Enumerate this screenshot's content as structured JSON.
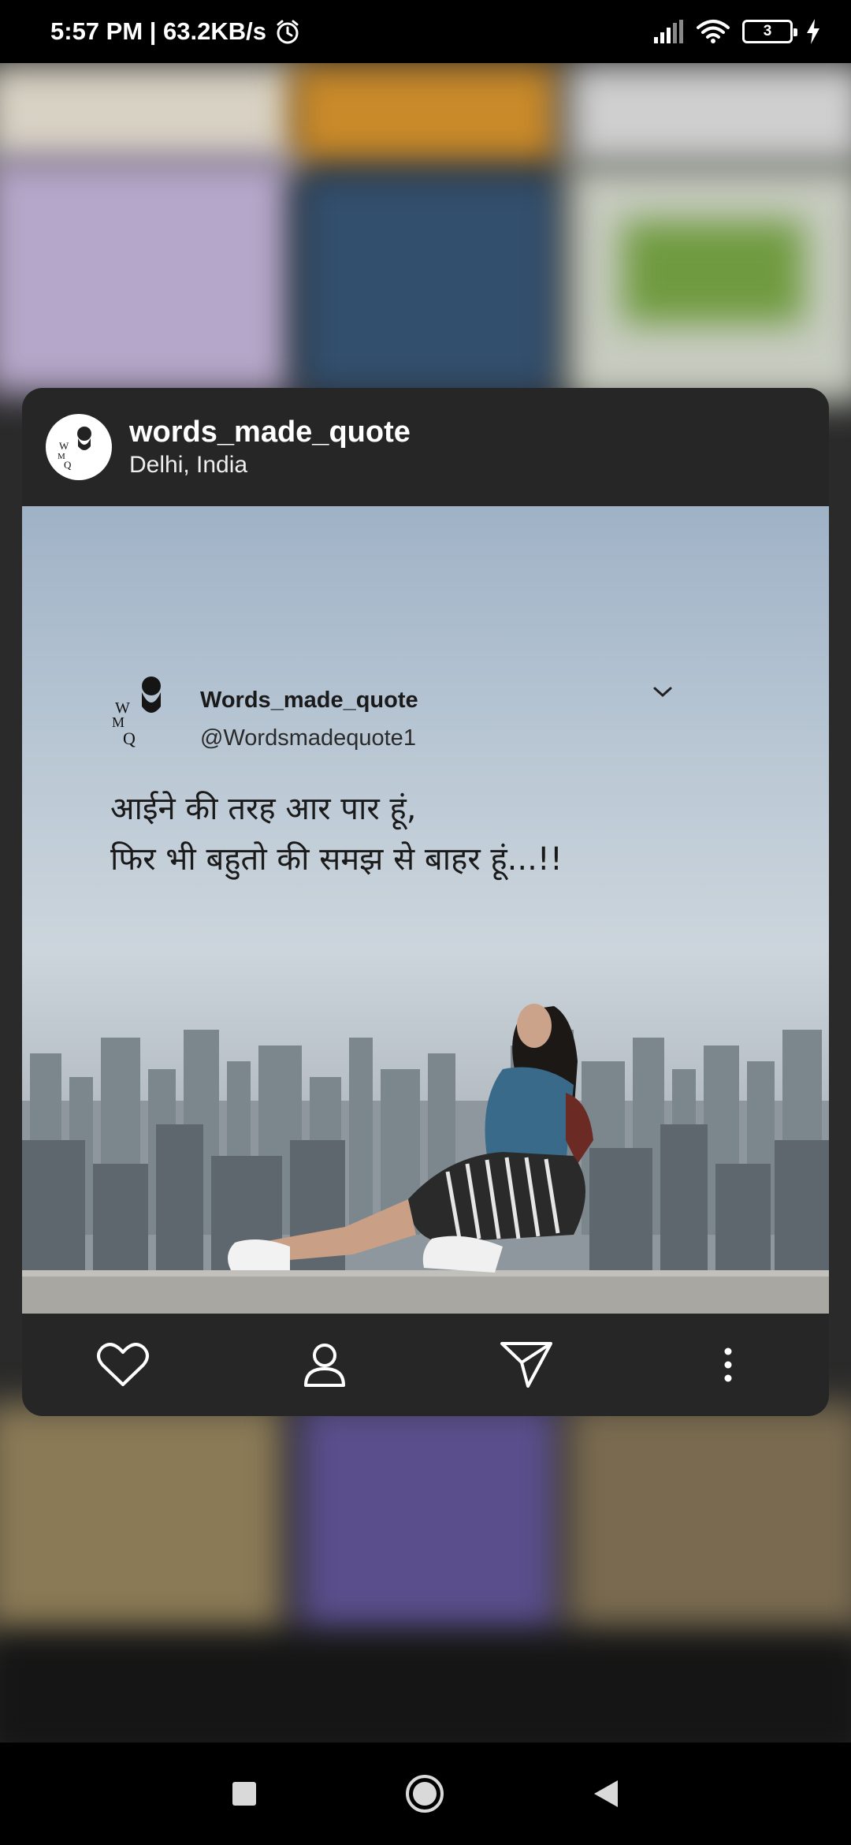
{
  "status_bar": {
    "time_speed": "5:57 PM | 63.2KB/s",
    "battery_level": "3"
  },
  "post": {
    "username": "words_made_quote",
    "location": "Delhi, India",
    "image": {
      "tweet_name": "Words_made_quote",
      "tweet_handle": "@Wordsmadequote1",
      "quote_line1": "आईने की तरह आर पार हूं,",
      "quote_line2": "फिर भी बहुतो की समझ से बाहर हूं...!!"
    }
  },
  "icons": {
    "alarm": "alarm-icon",
    "signal": "signal-icon",
    "wifi": "wifi-icon",
    "charging": "charging-bolt-icon",
    "like": "heart-icon",
    "profile": "person-icon",
    "share": "send-icon",
    "more": "more-vertical-icon",
    "recents": "square-icon",
    "home": "circle-icon",
    "back": "triangle-back-icon"
  }
}
